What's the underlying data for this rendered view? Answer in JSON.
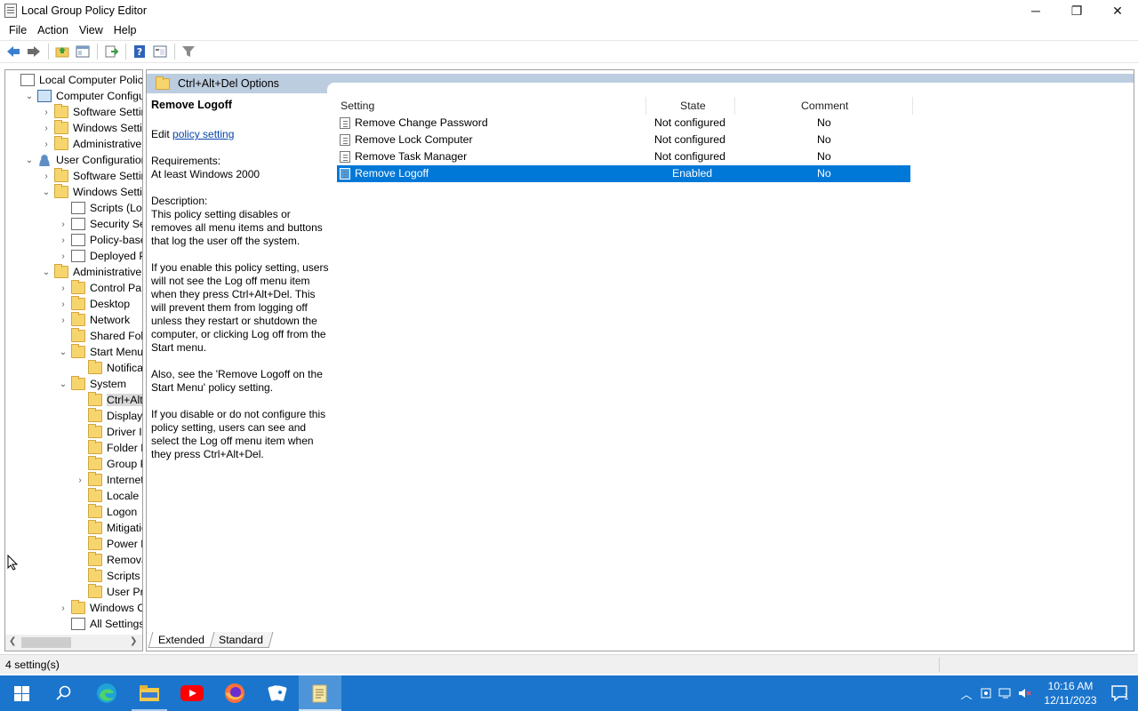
{
  "window": {
    "title": "Local Group Policy Editor",
    "controls": {
      "minimize": "─",
      "maximize": "❐",
      "close": "✕"
    }
  },
  "menubar": [
    "File",
    "Action",
    "View",
    "Help"
  ],
  "toolbar": {
    "buttons": [
      "back-icon",
      "forward-icon",
      "up-folder-icon",
      "show-hide-console-tree-icon",
      "export-list-icon",
      "help-icon",
      "properties-icon",
      "filter-icon"
    ]
  },
  "tree": {
    "nodes": [
      {
        "label": "Local Computer Policy",
        "expander": "",
        "icon": "policy-doc-icon"
      },
      {
        "label": "Computer Configura",
        "expander": "⌄",
        "icon": "computer-icon"
      },
      {
        "label": "Software Settings",
        "expander": "›",
        "icon": "folder-icon"
      },
      {
        "label": "Windows Setting",
        "expander": "›",
        "icon": "folder-icon"
      },
      {
        "label": "Administrative Te",
        "expander": "›",
        "icon": "folder-icon"
      },
      {
        "label": "User Configuration",
        "expander": "⌄",
        "icon": "user-icon"
      },
      {
        "label": "Software Settings",
        "expander": "›",
        "icon": "folder-icon"
      },
      {
        "label": "Windows Setting",
        "expander": "⌄",
        "icon": "folder-icon"
      },
      {
        "label": "Scripts (Logon",
        "expander": "",
        "icon": "script-icon"
      },
      {
        "label": "Security Setti",
        "expander": "›",
        "icon": "security-icon"
      },
      {
        "label": "Policy-based",
        "expander": "›",
        "icon": "chart-icon"
      },
      {
        "label": "Deployed Prir",
        "expander": "›",
        "icon": "printer-icon"
      },
      {
        "label": "Administrative Te",
        "expander": "⌄",
        "icon": "folder-icon"
      },
      {
        "label": "Control Panel",
        "expander": "›",
        "icon": "folder-icon"
      },
      {
        "label": "Desktop",
        "expander": "›",
        "icon": "folder-icon"
      },
      {
        "label": "Network",
        "expander": "›",
        "icon": "folder-icon"
      },
      {
        "label": "Shared Folder",
        "expander": "",
        "icon": "folder-icon"
      },
      {
        "label": "Start Menu ar",
        "expander": "⌄",
        "icon": "folder-icon"
      },
      {
        "label": "Notificatio",
        "expander": "",
        "icon": "folder-icon"
      },
      {
        "label": "System",
        "expander": "⌄",
        "icon": "folder-icon"
      },
      {
        "label": "Ctrl+Alt+I",
        "expander": "",
        "icon": "folder-icon"
      },
      {
        "label": "Display",
        "expander": "",
        "icon": "folder-icon"
      },
      {
        "label": "Driver Inst",
        "expander": "",
        "icon": "folder-icon"
      },
      {
        "label": "Folder Rec",
        "expander": "",
        "icon": "folder-icon"
      },
      {
        "label": "Group Pol",
        "expander": "",
        "icon": "folder-icon"
      },
      {
        "label": "Internet C",
        "expander": "›",
        "icon": "folder-icon"
      },
      {
        "label": "Locale Ser",
        "expander": "",
        "icon": "folder-icon"
      },
      {
        "label": "Logon",
        "expander": "",
        "icon": "folder-icon"
      },
      {
        "label": "Mitigation",
        "expander": "",
        "icon": "folder-icon"
      },
      {
        "label": "Power Ma",
        "expander": "",
        "icon": "folder-icon"
      },
      {
        "label": "Removabl",
        "expander": "",
        "icon": "folder-icon"
      },
      {
        "label": "Scripts",
        "expander": "",
        "icon": "folder-icon"
      },
      {
        "label": "User Profi",
        "expander": "",
        "icon": "folder-icon"
      },
      {
        "label": "Windows Cor",
        "expander": "›",
        "icon": "folder-icon"
      },
      {
        "label": "All Settings",
        "expander": "",
        "icon": "all-settings-icon"
      }
    ]
  },
  "right": {
    "header": "Ctrl+Alt+Del Options",
    "description": {
      "title": "Remove Logoff",
      "edit_prefix": "Edit ",
      "edit_link": "policy setting ",
      "requirements_label": "Requirements:",
      "requirements_value": "At least Windows 2000",
      "description_label": "Description:",
      "p1": "This policy setting disables or removes all menu items and buttons that log the user off the system.",
      "p2": "If you enable this policy setting, users will not see the Log off menu item when they press Ctrl+Alt+Del. This will prevent them from logging off unless they restart or shutdown the computer, or clicking Log off from the Start menu.",
      "p3": "Also, see the 'Remove Logoff on the Start Menu' policy setting.",
      "p4": "If you disable or do not configure this policy setting, users can see and select the Log off menu item when they press Ctrl+Alt+Del."
    },
    "columns": {
      "setting": "Setting",
      "state": "State",
      "comment": "Comment"
    },
    "rows": [
      {
        "setting": "Remove Change Password",
        "state": "Not configured",
        "comment": "No"
      },
      {
        "setting": "Remove Lock Computer",
        "state": "Not configured",
        "comment": "No"
      },
      {
        "setting": "Remove Task Manager",
        "state": "Not configured",
        "comment": "No"
      },
      {
        "setting": "Remove Logoff",
        "state": "Enabled",
        "comment": "No"
      }
    ],
    "tabs": [
      "Extended",
      "Standard"
    ]
  },
  "statusbar": {
    "text": "4 setting(s)"
  },
  "taskbar": {
    "apps": [
      "start-icon",
      "search-icon",
      "edge-icon",
      "file-explorer-icon",
      "youtube-icon",
      "firefox-icon",
      "solitaire-icon",
      "notepad-icon"
    ],
    "time": "10:16 AM",
    "date": "12/11/2023",
    "notification_count": "1"
  },
  "colors": {
    "selection": "#0078d7",
    "header_band": "#bccde0",
    "taskbar": "#1b75cc",
    "link": "#0645ad"
  }
}
